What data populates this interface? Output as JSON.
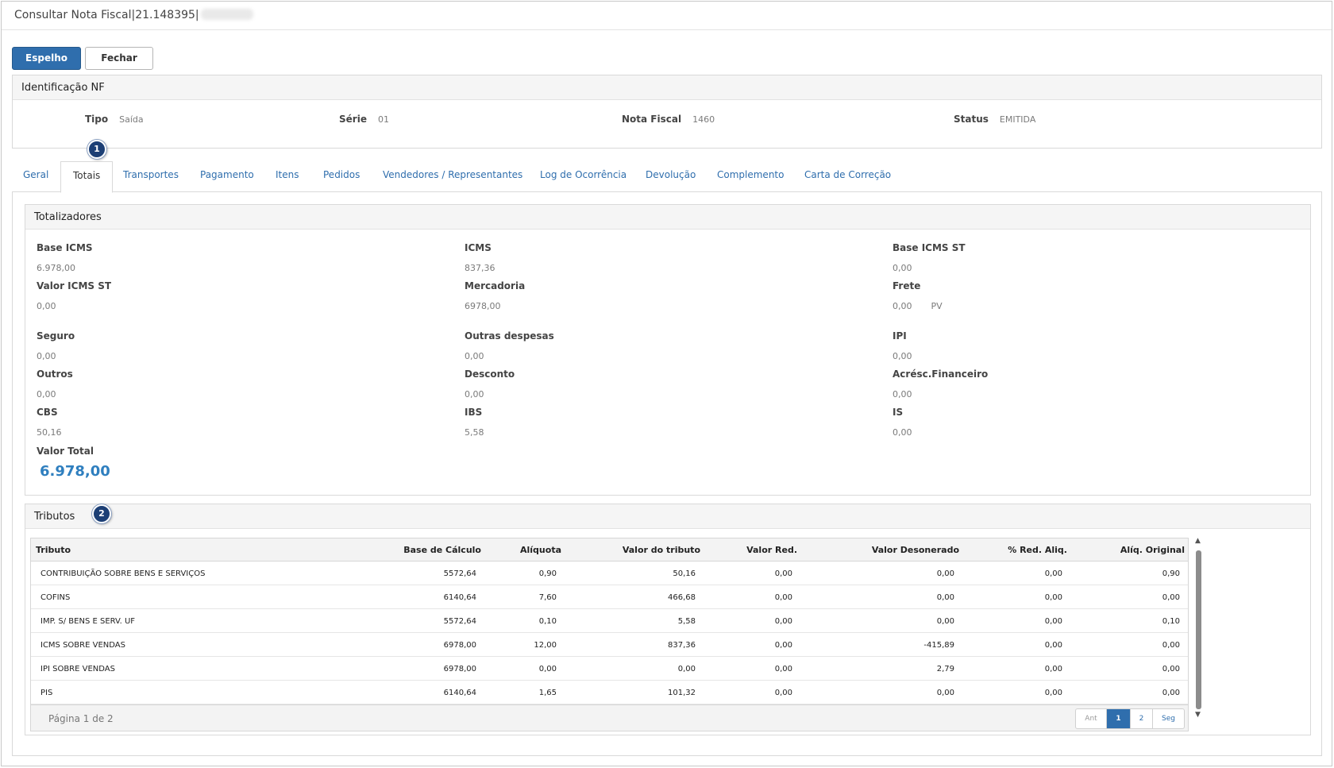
{
  "window": {
    "title": "Consultar Nota Fiscal|21.148395|"
  },
  "toolbar": {
    "espelho_label": "Espelho",
    "fechar_label": "Fechar"
  },
  "identificacao": {
    "title": "Identificação NF",
    "tipo_label": "Tipo",
    "tipo_value": "Saída",
    "serie_label": "Série",
    "serie_value": "01",
    "nota_label": "Nota Fiscal",
    "nota_value": "1460",
    "status_label": "Status",
    "status_value": "EMITIDA"
  },
  "badges": [
    "1",
    "2"
  ],
  "tabs": [
    {
      "label": "Geral"
    },
    {
      "label": "Totais",
      "active": true
    },
    {
      "label": "Transportes"
    },
    {
      "label": "Pagamento"
    },
    {
      "label": "Itens"
    },
    {
      "label": "Pedidos"
    },
    {
      "label": "Vendedores / Representantes"
    },
    {
      "label": "Log de Ocorrência"
    },
    {
      "label": "Devolução"
    },
    {
      "label": "Complemento"
    },
    {
      "label": "Carta de Correção"
    }
  ],
  "totalizadores": {
    "title": "Totalizadores",
    "fields": [
      {
        "label": "Base ICMS",
        "value": "6.978,00"
      },
      {
        "label": "ICMS",
        "value": "837,36"
      },
      {
        "label": "Base ICMS ST",
        "value": "0,00"
      },
      {
        "label": "Valor ICMS ST",
        "value": "0,00"
      },
      {
        "label": "Mercadoria",
        "value": "6978,00"
      },
      {
        "label": "Frete",
        "value": "0,00",
        "extra": "PV"
      },
      {
        "label": "Seguro",
        "value": "0,00"
      },
      {
        "label": "Outras despesas",
        "value": "0,00"
      },
      {
        "label": "IPI",
        "value": "0,00"
      },
      {
        "label": "Outros",
        "value": "0,00"
      },
      {
        "label": "Desconto",
        "value": "0,00"
      },
      {
        "label": "Acrésc.Financeiro",
        "value": "0,00"
      },
      {
        "label": "CBS",
        "value": "50,16"
      },
      {
        "label": "IBS",
        "value": "5,58"
      },
      {
        "label": "IS",
        "value": "0,00"
      }
    ],
    "valor_total_label": "Valor Total",
    "valor_total": "6.978,00"
  },
  "tributos": {
    "title": "Tributos",
    "columns": [
      "Tributo",
      "Base de Cálculo",
      "Alíquota",
      "Valor do tributo",
      "Valor Red.",
      "Valor Desonerado",
      "% Red. Aliq.",
      "Alíq. Original"
    ],
    "rows": [
      [
        "CONTRIBUIÇÃO SOBRE BENS E SERVIÇOS",
        "5572,64",
        "0,90",
        "50,16",
        "0,00",
        "0,00",
        "0,00",
        "0,90"
      ],
      [
        "COFINS",
        "6140,64",
        "7,60",
        "466,68",
        "0,00",
        "0,00",
        "0,00",
        "0,00"
      ],
      [
        "IMP. S/ BENS E SERV. UF",
        "5572,64",
        "0,10",
        "5,58",
        "0,00",
        "0,00",
        "0,00",
        "0,10"
      ],
      [
        "ICMS SOBRE VENDAS",
        "6978,00",
        "12,00",
        "837,36",
        "0,00",
        "-415,89",
        "0,00",
        "0,00"
      ],
      [
        "IPI SOBRE VENDAS",
        "6978,00",
        "0,00",
        "0,00",
        "0,00",
        "2,79",
        "0,00",
        "0,00"
      ],
      [
        "PIS",
        "6140,64",
        "1,65",
        "101,32",
        "0,00",
        "0,00",
        "0,00",
        "0,00"
      ]
    ],
    "page_info": "Página 1 de 2",
    "pager": {
      "prev": "Ant",
      "pages": [
        "1",
        "2"
      ],
      "current": "1",
      "next": "Seg"
    }
  },
  "colors": {
    "primary": "#2f6ead",
    "badge": "#1c3f75",
    "total": "#2f7fbf"
  }
}
